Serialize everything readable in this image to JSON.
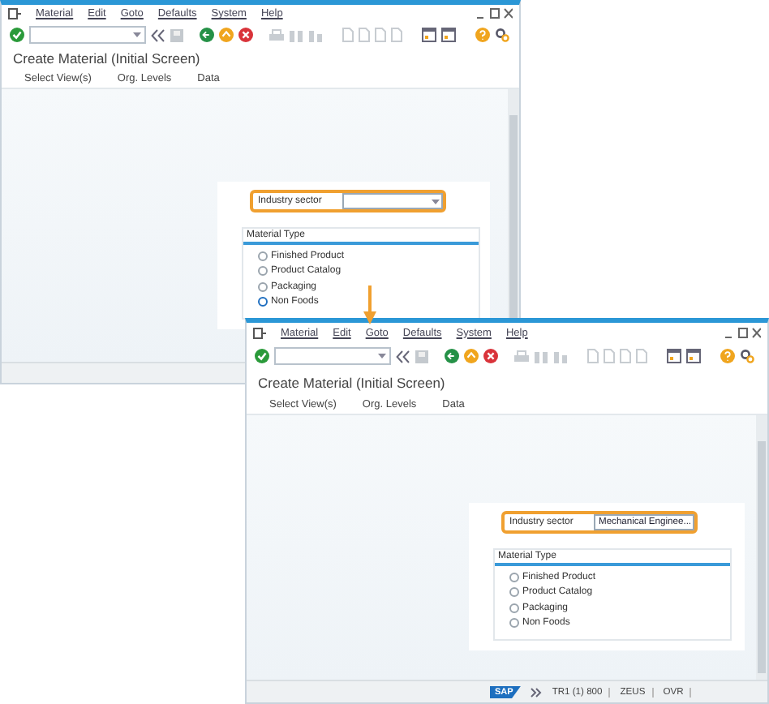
{
  "windows": [
    {
      "menu": [
        "Material",
        "Edit",
        "Goto",
        "Defaults",
        "System",
        "Help"
      ],
      "title": "Create Material (Initial Screen)",
      "app_toolbar": [
        "Select View(s)",
        "Org. Levels",
        "Data"
      ],
      "industry_sector": {
        "label": "Industry sector",
        "highlighted": true
      },
      "material_type": {
        "label": "Material Type",
        "options": [
          {
            "label": "Finished Product",
            "selected": false
          },
          {
            "label": "Product Catalog",
            "selected": false
          },
          {
            "label": "Packaging",
            "selected": false
          },
          {
            "label": "Non Foods",
            "selected": true
          }
        ]
      }
    },
    {
      "menu": [
        "Material",
        "Edit",
        "Goto",
        "Defaults",
        "System",
        "Help"
      ],
      "title": "Create Material (Initial Screen)",
      "app_toolbar": [
        "Select View(s)",
        "Org. Levels",
        "Data"
      ],
      "industry_sector": {
        "label": "Industry sector",
        "value": "Mechanical Enginee...",
        "highlighted": true
      },
      "material_type": {
        "label": "Material Type",
        "options": [
          {
            "label": "Finished Product",
            "selected": false
          },
          {
            "label": "Product Catalog",
            "selected": false
          },
          {
            "label": "Packaging",
            "selected": false
          },
          {
            "label": "Non Foods",
            "selected": false
          }
        ]
      },
      "status_bar": {
        "logo": "SAP",
        "items": [
          "TR1 (1) 800",
          "ZEUS",
          "OVR"
        ]
      }
    }
  ]
}
